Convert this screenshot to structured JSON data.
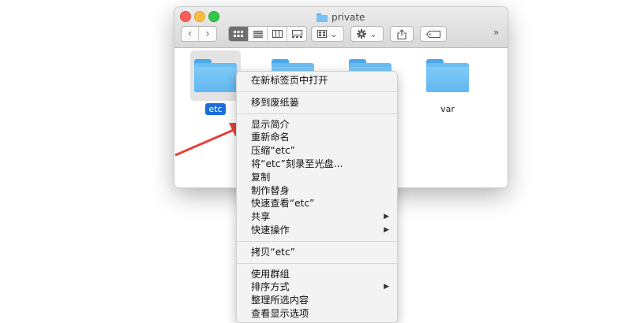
{
  "window": {
    "title": "private",
    "toolbar": {
      "back_icon": "‹",
      "forward_icon": "›",
      "view_icons": [
        "icon-view-icon",
        "list-view-icon",
        "column-view-icon",
        "gallery-view-icon"
      ],
      "arrange_caret": "⌄",
      "action_caret": "⌄",
      "share_icon": "share-icon",
      "tag_icon": "tag-icon",
      "more_label": "»"
    }
  },
  "folders": [
    {
      "name": "etc",
      "selected": true
    },
    {
      "name": "",
      "selected": false
    },
    {
      "name": "",
      "selected": false
    },
    {
      "name": "var",
      "selected": false
    }
  ],
  "context_menu": {
    "groups": [
      [
        {
          "label": "在新标签页中打开",
          "submenu": false
        }
      ],
      [
        {
          "label": "移到废纸篓",
          "submenu": false
        }
      ],
      [
        {
          "label": "显示简介",
          "submenu": false
        },
        {
          "label": "重新命名",
          "submenu": false
        },
        {
          "label": "压缩“etc”",
          "submenu": false
        },
        {
          "label": "将“etc”刻录至光盘...",
          "submenu": false
        },
        {
          "label": "复制",
          "submenu": false
        },
        {
          "label": "制作替身",
          "submenu": false
        },
        {
          "label": "快速查看“etc”",
          "submenu": false
        },
        {
          "label": "共享",
          "submenu": true
        },
        {
          "label": "快速操作",
          "submenu": true
        }
      ],
      [
        {
          "label": "拷贝“etc”",
          "submenu": false
        }
      ],
      [
        {
          "label": "使用群组",
          "submenu": false
        },
        {
          "label": "排序方式",
          "submenu": true
        },
        {
          "label": "整理所选内容",
          "submenu": false
        },
        {
          "label": "查看显示选项",
          "submenu": false
        }
      ]
    ],
    "submenu_glyph": "▶"
  },
  "colors": {
    "selection": "#1b6dd8",
    "folder": "#6cbdf4",
    "annotation_arrow": "#e8403a"
  }
}
